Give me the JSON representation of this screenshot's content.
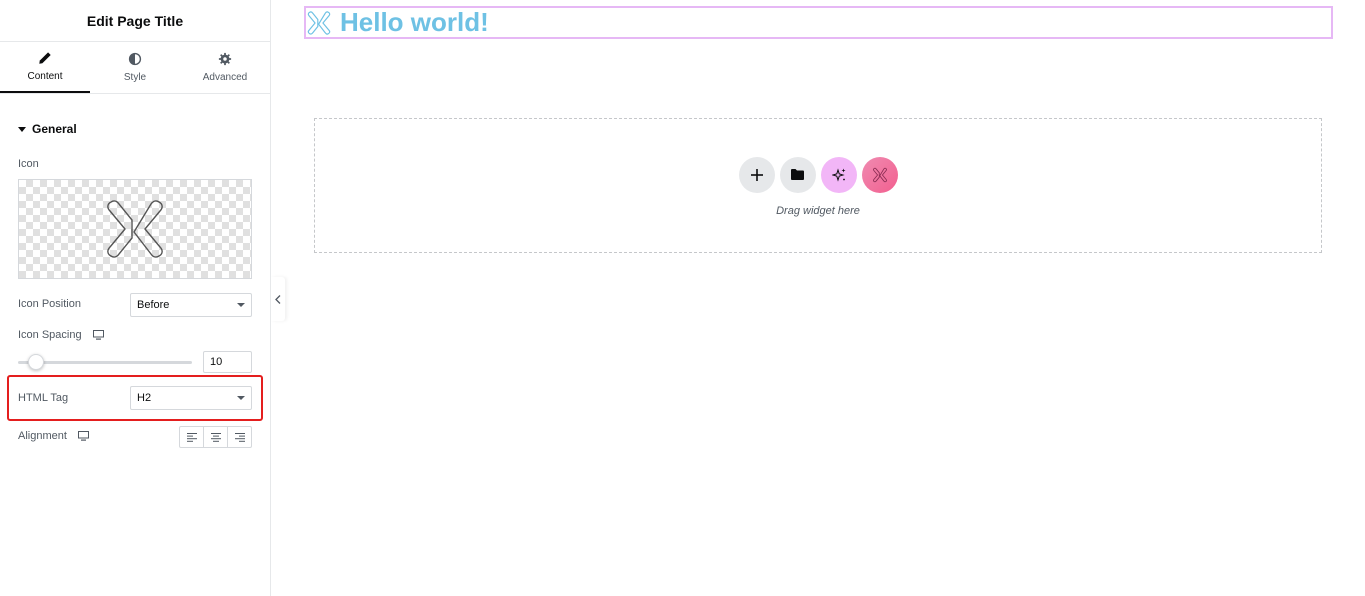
{
  "panel": {
    "title": "Edit Page Title",
    "tabs": [
      {
        "label": "Content",
        "icon": "pencil-icon",
        "active": true
      },
      {
        "label": "Style",
        "icon": "half-circle-icon",
        "active": false
      },
      {
        "label": "Advanced",
        "icon": "gear-icon",
        "active": false
      }
    ],
    "section_title": "General",
    "icon_label": "Icon",
    "icon_position": {
      "label": "Icon Position",
      "value": "Before"
    },
    "icon_spacing": {
      "label": "Icon Spacing",
      "value": "10",
      "slider_fraction": 0.1
    },
    "html_tag": {
      "label": "HTML Tag",
      "value": "H2"
    },
    "alignment": {
      "label": "Alignment",
      "options": [
        "left",
        "center",
        "right"
      ]
    }
  },
  "canvas": {
    "heading_text": "Hello world!",
    "heading_color": "#6ec1e4",
    "drop_text": "Drag widget here",
    "buttons": [
      {
        "name": "add-section-button",
        "icon": "plus-icon",
        "color": "#e6e8ea"
      },
      {
        "name": "templates-button",
        "icon": "folder-icon",
        "color": "#e6e8ea"
      },
      {
        "name": "ai-button",
        "icon": "sparkles-icon",
        "color": "#f2b6f7"
      },
      {
        "name": "kit-button",
        "icon": "x-logo-icon",
        "color": "#f25f8f"
      }
    ]
  },
  "colors": {
    "highlight": "#e41e1e",
    "frame": "#e6b8f5"
  }
}
